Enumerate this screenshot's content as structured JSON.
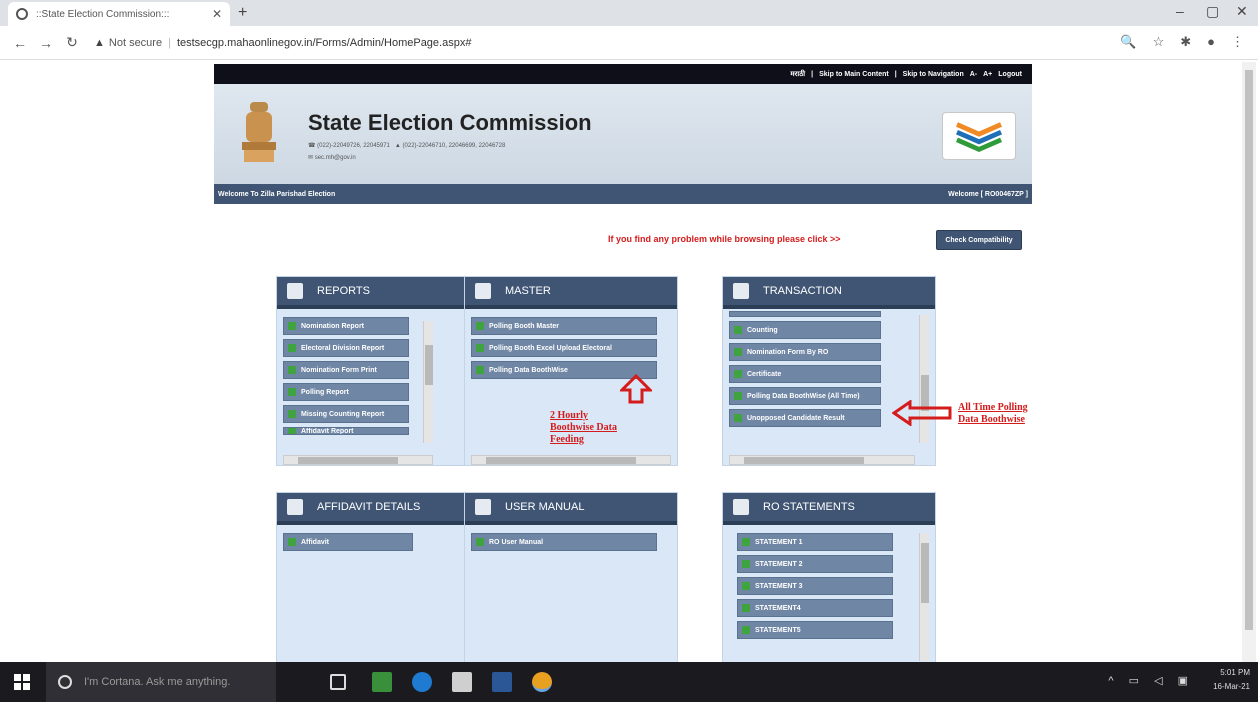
{
  "browser": {
    "tab_title": "::State Election Commission:::",
    "url_security": "Not secure",
    "url": "testsecgp.mahaonlinegov.in/Forms/Admin/HomePage.aspx#"
  },
  "topbar": {
    "lang": "मराठी",
    "skip_main": "Skip to Main Content",
    "skip_nav": "Skip to Navigation",
    "font_small": "A-",
    "font_large": "A+",
    "logout": "Logout"
  },
  "header": {
    "title": "State Election Commission",
    "phone": "(022)-22049726, 22045971",
    "fax": "(022)-22046710, 22046699, 22046728",
    "email": "sec.mh@gov.in"
  },
  "welcome": {
    "left": "Welcome To Zilla Parishad Election",
    "right": "Welcome [ RO00467ZP ]"
  },
  "problem_text": "If you find any problem while browsing please click >>",
  "compat_button": "Check Compatibility",
  "panels": {
    "reports": {
      "title": "REPORTS",
      "items": [
        "Nomination Report",
        "Electoral Division Report",
        "Nomination Form Print",
        "Polling Report",
        "Missing Counting Report",
        "Affidavit Report"
      ]
    },
    "master": {
      "title": "MASTER",
      "items": [
        "Polling Booth Master",
        "Polling Booth Excel Upload Electoral",
        "Polling Data BoothWise"
      ]
    },
    "transaction": {
      "title": "TRANSACTION",
      "items": [
        "Counting",
        "Nomination Form By RO",
        "Certificate",
        "Polling Data BoothWise (All Time)",
        "Unopposed Candidate Result"
      ]
    },
    "affidavit": {
      "title": "AFFIDAVIT DETAILS",
      "items": [
        "Affidavit"
      ]
    },
    "manual": {
      "title": "USER MANUAL",
      "items": [
        "RO User Manual"
      ]
    },
    "statements": {
      "title": "RO STATEMENTS",
      "items": [
        "STATEMENT 1",
        "STATEMENT 2",
        "STATEMENT 3",
        "STATEMENT4",
        "STATEMENT5"
      ]
    }
  },
  "annotations": {
    "two_hourly": [
      "2 Hourly",
      "Boothwise Data",
      "Feeding"
    ],
    "all_time": [
      "All Time Polling",
      "Data Boothwise"
    ]
  },
  "taskbar": {
    "cortana_text": "I'm Cortana. Ask me anything.",
    "time": "5:01 PM",
    "date": "16-Mar-21"
  },
  "colors": {
    "panel_header": "#3f5573",
    "item_bg": "#6f86a5",
    "note_red": "#d41c1c"
  }
}
